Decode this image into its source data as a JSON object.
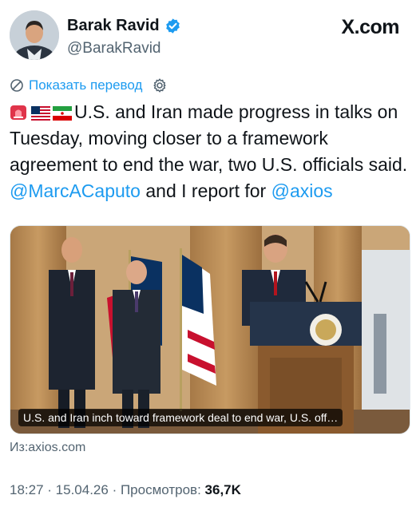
{
  "author": {
    "display_name": "Barak Ravid",
    "handle": "@BarakRavid",
    "verified": true,
    "verified_color": "#1d9bf0"
  },
  "brand": {
    "logo_text": "X.com"
  },
  "translate": {
    "label": "Показать перевод"
  },
  "tweet": {
    "text_main": "U.S. and Iran made progress in talks on Tuesday, moving closer to a framework agreement to end the war, two U.S. officials said. ",
    "mention_1": "@MarcACaputo",
    "text_middle": " and I report for ",
    "mention_2": "@axios",
    "emojis": [
      "siren-emoji",
      "us-flag-emoji",
      "iran-flag-emoji"
    ]
  },
  "media": {
    "caption": "U.S. and Iran inch toward framework deal to end war, U.S. off…"
  },
  "link_source": "Из:axios.com",
  "meta": {
    "time": "18:27",
    "separator_1": " · ",
    "date": "15.04.26",
    "separator_2": " · ",
    "views_label": "Просмотров: ",
    "views_count": "36,7K"
  },
  "colors": {
    "accent": "#1d9bf0",
    "text": "#0f1419",
    "secondary": "#536471"
  }
}
